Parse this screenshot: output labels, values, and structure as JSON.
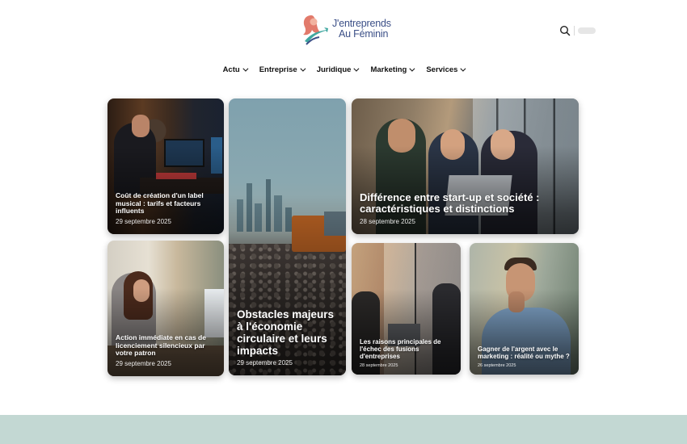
{
  "header": {
    "logo_line1": "J'entreprends",
    "logo_line2": "Au Féminin",
    "search_icon": "search-icon"
  },
  "nav": {
    "items": [
      {
        "label": "Actu"
      },
      {
        "label": "Entreprise"
      },
      {
        "label": "Juridique"
      },
      {
        "label": "Marketing"
      },
      {
        "label": "Services"
      }
    ]
  },
  "articles": [
    {
      "title": "Coût de création d'un label musical : tarifs et facteurs influents",
      "date": "29 septembre 2025"
    },
    {
      "title": "Obstacles majeurs à l'économie circulaire et leurs impacts",
      "date": "29 septembre 2025"
    },
    {
      "title": "Différence entre start-up et société : caractéristiques et distinctions",
      "date": "28 septembre 2025"
    },
    {
      "title": "Action immédiate en cas de licenciement silencieux par votre patron",
      "date": "29 septembre 2025"
    },
    {
      "title": "Les raisons principales de l'échec des fusions d'entreprises",
      "date": "28 septembre 2025"
    },
    {
      "title": "Gagner de l'argent avec le marketing : réalité ou mythe ?",
      "date": "26 septembre 2025"
    }
  ],
  "colors": {
    "brand_blue": "#3b4f87",
    "brand_teal": "#3fa7a0",
    "brand_coral": "#e27a6b",
    "footer_band": "#c3d8d3"
  }
}
